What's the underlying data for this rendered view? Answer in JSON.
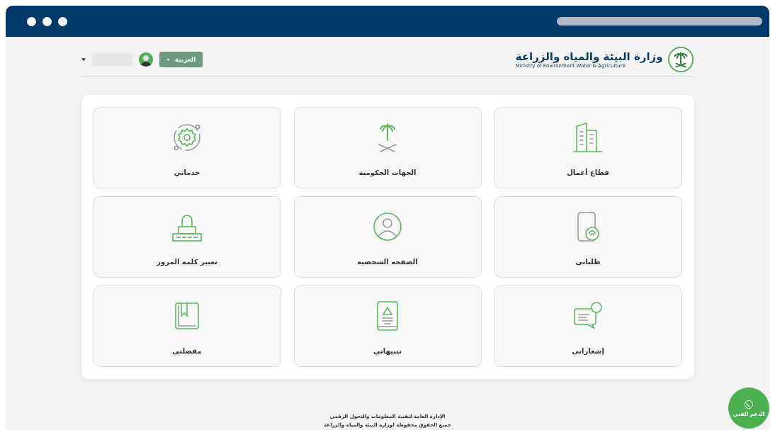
{
  "header": {
    "ministry_name_ar": "وزارة البيئة والمياه والزراعة",
    "ministry_name_en": "Ministry of Environment Water & Agriculture",
    "language_button": "العربية"
  },
  "tiles": [
    {
      "label": "قطاع أعمال",
      "kind": "building"
    },
    {
      "label": "الجهات الحكومية",
      "kind": "palm"
    },
    {
      "label": "خدماتي",
      "kind": "gear"
    },
    {
      "label": "طلباتي",
      "kind": "phone"
    },
    {
      "label": "الصفحه الشخصيه",
      "kind": "person"
    },
    {
      "label": "تغيير كلمه المرور",
      "kind": "lock"
    },
    {
      "label": "إشعاراتي",
      "kind": "chat"
    },
    {
      "label": "تنبيهاتي",
      "kind": "tablet"
    },
    {
      "label": "مفضلتي",
      "kind": "bookmark"
    }
  ],
  "footer": {
    "line_1": "الإدارة العامة لتقنية المعلومات والتحول الرقمي",
    "line_2": "جميع الحقوق محفوظة لوزارة البيئة والمياه والزراعة"
  },
  "support_button": "الدعم الفني"
}
